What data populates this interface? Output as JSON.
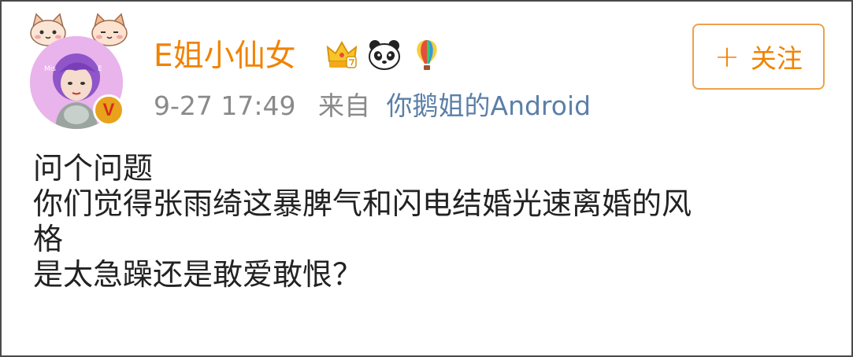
{
  "user": {
    "name": "E姐小仙女",
    "badges": [
      "crown-vip-icon",
      "panda-icon",
      "balloon-icon"
    ],
    "verified_mark": "V"
  },
  "post_meta": {
    "time": "9-27 17:49",
    "from_label": "来自",
    "source": "你鹅姐的Android"
  },
  "follow_button": {
    "plus": "+",
    "label": "关注"
  },
  "post": {
    "lines": [
      "问个问题",
      "你们觉得张雨绮这暴脾气和闪电结婚光速离婚的风",
      "格",
      "是太急躁还是敢爱敢恨？"
    ]
  },
  "colors": {
    "name": "#f08300",
    "source": "#5b7fa8",
    "meta": "#8a8a8a",
    "follow_border": "#f0a04a"
  }
}
